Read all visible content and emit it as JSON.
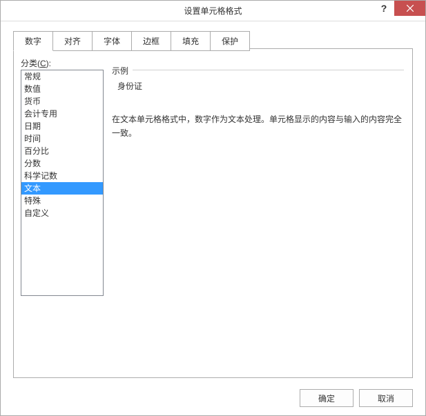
{
  "titlebar": {
    "title": "设置单元格格式",
    "help": "?",
    "close": "×"
  },
  "tabs": [
    {
      "label": "数字",
      "active": true
    },
    {
      "label": "对齐",
      "active": false
    },
    {
      "label": "字体",
      "active": false
    },
    {
      "label": "边框",
      "active": false
    },
    {
      "label": "填充",
      "active": false
    },
    {
      "label": "保护",
      "active": false
    }
  ],
  "category": {
    "label_prefix": "分类(",
    "label_key": "C",
    "label_suffix": "):",
    "items": [
      "常规",
      "数值",
      "货币",
      "会计专用",
      "日期",
      "时间",
      "百分比",
      "分数",
      "科学记数",
      "文本",
      "特殊",
      "自定义"
    ],
    "selected_index": 9
  },
  "preview": {
    "legend": "示例",
    "value": "身份证"
  },
  "description": "在文本单元格格式中，数字作为文本处理。单元格显示的内容与输入的内容完全一致。",
  "footer": {
    "ok": "确定",
    "cancel": "取消"
  }
}
